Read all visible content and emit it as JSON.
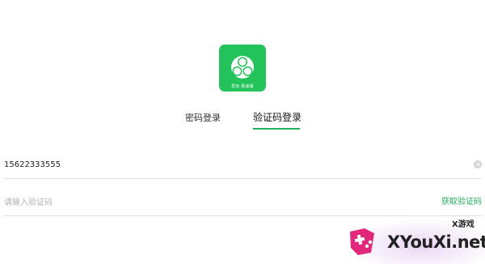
{
  "app": {
    "logo_text": "爱玩·极速版",
    "brand_color": "#22c35a"
  },
  "tabs": [
    {
      "label": "密码登录",
      "active": false
    },
    {
      "label": "验证码登录",
      "active": true
    }
  ],
  "form": {
    "phone_value": "15622333555",
    "code_placeholder": "请输入验证码",
    "get_code_label": "获取验证码",
    "accent_color": "#22b15a"
  },
  "icons": {
    "clear": "clear-circle-icon",
    "logo": "three-circles-icon"
  },
  "watermark": {
    "small_text": "X游戏",
    "big_text": "XYouXi.net",
    "badge_icon": "gamepad-icon"
  }
}
